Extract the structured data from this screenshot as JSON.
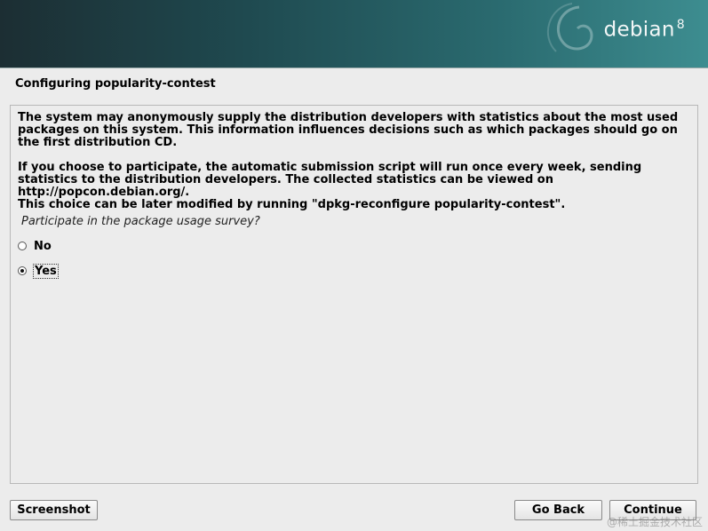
{
  "header": {
    "brand": "debian",
    "version": "8"
  },
  "page": {
    "title": "Configuring popularity-contest",
    "paragraph1": "The system may anonymously supply the distribution developers with statistics about the most used packages on this system. This information influences decisions such as which packages should go on the first distribution CD.",
    "paragraph2": "If you choose to participate, the automatic submission script will run once every week, sending statistics to the distribution developers. The collected statistics can be viewed on http://popcon.debian.org/.",
    "paragraph3": "This choice can be later modified by running \"dpkg-reconfigure popularity-contest\".",
    "question": "Participate in the package usage survey?"
  },
  "options": [
    {
      "label": "No",
      "selected": false
    },
    {
      "label": "Yes",
      "selected": true
    }
  ],
  "buttons": {
    "screenshot": "Screenshot",
    "go_back": "Go Back",
    "continue": "Continue"
  },
  "watermark": "@稀土掘金技术社区"
}
